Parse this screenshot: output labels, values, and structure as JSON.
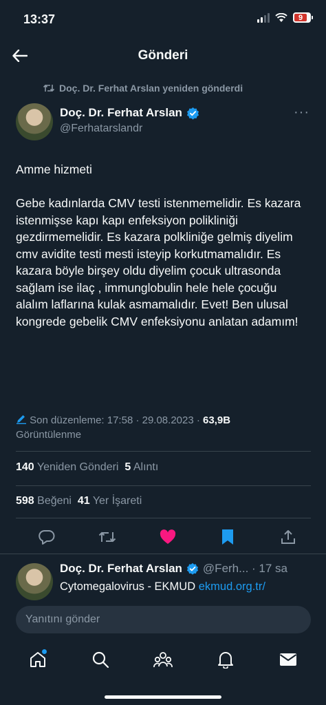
{
  "status_bar": {
    "time": "13:37",
    "battery": "9",
    "icons": [
      "signal-icon",
      "wifi-icon",
      "battery-icon"
    ]
  },
  "header": {
    "title": "Gönderi",
    "back_icon": "arrow-left-icon"
  },
  "retweet_note": "Doç. Dr. Ferhat Arslan yeniden gönderdi",
  "author": {
    "name": "Doç. Dr. Ferhat Arslan",
    "handle": "@Ferhatarslandr",
    "verified": true
  },
  "tweet": {
    "text": "Amme hizmeti\n\nGebe kadınlarda CMV testi istenmemelidir. Es kazara istenmişse kapı kapı enfeksiyon polikliniği gezdirmemelidir. Es kazara polkliniğe gelmiş diyelim cmv avidite testi mesti isteyip korkutmamalıdır. Es kazara böyle birşey oldu diyelim çocuk ultrasonda sağlam ise ilaç , immunglobulin hele hele çocuğu alalım laflarına kulak asmamalıdır. Evet! Ben ulusal kongrede gebelik CMV enfeksiyonu anlatan adamım!",
    "edited_label": "Son düzenleme: 17:58 · 29.08.2023 ·",
    "views_count": "63,9B",
    "views_label": "Görüntülenme"
  },
  "stats": {
    "retweets_count": "140",
    "retweets_label": "Yeniden Gönderi",
    "quotes_count": "5",
    "quotes_label": "Alıntı",
    "likes_count": "598",
    "likes_label": "Beğeni",
    "bookmarks_count": "41",
    "bookmarks_label": "Yer İşareti"
  },
  "colors": {
    "background": "#15202b",
    "accent": "#1d9bf0",
    "like": "#f91880",
    "muted": "#8b98a5"
  },
  "reply": {
    "name": "Doç. Dr. Ferhat Arslan",
    "handle_time": "@Ferh... · 17 sa",
    "text": "Cytomegalovirus - EKMUD",
    "link": "ekmud.org.tr/"
  },
  "compose": {
    "placeholder": "Yanıtını gönder"
  },
  "tabbar": {
    "items": [
      "home-icon",
      "search-icon",
      "communities-icon",
      "notifications-icon",
      "messages-icon"
    ]
  }
}
